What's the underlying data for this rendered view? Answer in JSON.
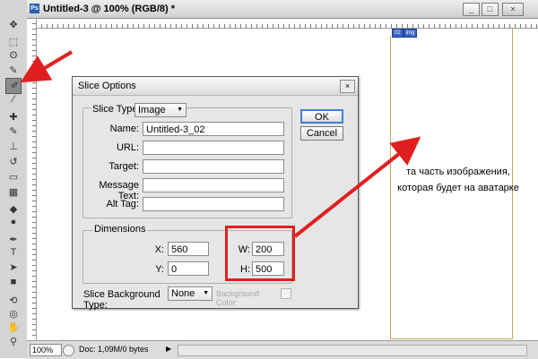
{
  "window": {
    "title": "Untitled-3 @ 100% (RGB/8) *",
    "app_icon_text": "Ps",
    "minimize": "_",
    "maximize": "□",
    "close": "×"
  },
  "tools": [
    {
      "icon": "move-icon",
      "glyph": "✥"
    },
    {
      "icon": "marquee-icon",
      "glyph": "⬚"
    },
    {
      "icon": "lasso-icon",
      "glyph": "ʘ"
    },
    {
      "icon": "quick-select-icon",
      "glyph": "✎"
    },
    {
      "icon": "slice-icon",
      "glyph": "✐",
      "selected": true
    },
    {
      "icon": "eyedropper-icon",
      "glyph": "⁄"
    },
    {
      "icon": "healing-brush-icon",
      "glyph": "✚"
    },
    {
      "icon": "brush-icon",
      "glyph": "✎"
    },
    {
      "icon": "clone-stamp-icon",
      "glyph": "⊥"
    },
    {
      "icon": "history-brush-icon",
      "glyph": "↺"
    },
    {
      "icon": "eraser-icon",
      "glyph": "▭"
    },
    {
      "icon": "gradient-icon",
      "glyph": "▦"
    },
    {
      "icon": "blur-icon",
      "glyph": "◆"
    },
    {
      "icon": "dodge-icon",
      "glyph": "●"
    },
    {
      "icon": "pen-icon",
      "glyph": "✒"
    },
    {
      "icon": "type-icon",
      "glyph": "T"
    },
    {
      "icon": "path-select-icon",
      "glyph": "➤"
    },
    {
      "icon": "shape-icon",
      "glyph": "■"
    },
    {
      "icon": "3d-rotate-icon",
      "glyph": "⟲"
    },
    {
      "icon": "3d-orbit-icon",
      "glyph": "◎"
    },
    {
      "icon": "hand-icon",
      "glyph": "✋"
    },
    {
      "icon": "zoom-icon",
      "glyph": "⚲"
    }
  ],
  "canvas": {
    "slice_badge_number": "02",
    "slice_badge_icon": "img",
    "annotation_line1": "та часть изображения,",
    "annotation_line2": "которая будет на аватарке"
  },
  "status": {
    "zoom": "100%",
    "doc_info": "Doc: 1,09M/0 bytes",
    "arrow": "▶"
  },
  "dialog": {
    "title": "Slice Options",
    "close": "×",
    "slice_type_label": "Slice Type:",
    "slice_type_value": "Image",
    "name_label": "Name:",
    "name_value": "Untitled-3_02",
    "url_label": "URL:",
    "url_value": "",
    "target_label": "Target:",
    "target_value": "",
    "message_label": "Message Text:",
    "message_value": "",
    "alt_label": "Alt Tag:",
    "alt_value": "",
    "dimensions_label": "Dimensions",
    "x_label": "X:",
    "x_value": "560",
    "y_label": "Y:",
    "y_value": "0",
    "w_label": "W:",
    "w_value": "200",
    "h_label": "H:",
    "h_value": "500",
    "bg_type_label": "Slice Background Type:",
    "bg_type_value": "None",
    "bg_color_label": "Background Color:",
    "ok_label": "OK",
    "cancel_label": "Cancel"
  },
  "colors": {
    "arrow_red": "#e02020",
    "slice_line": "#c9a65b",
    "default_button_border": "#3c7fd6"
  }
}
